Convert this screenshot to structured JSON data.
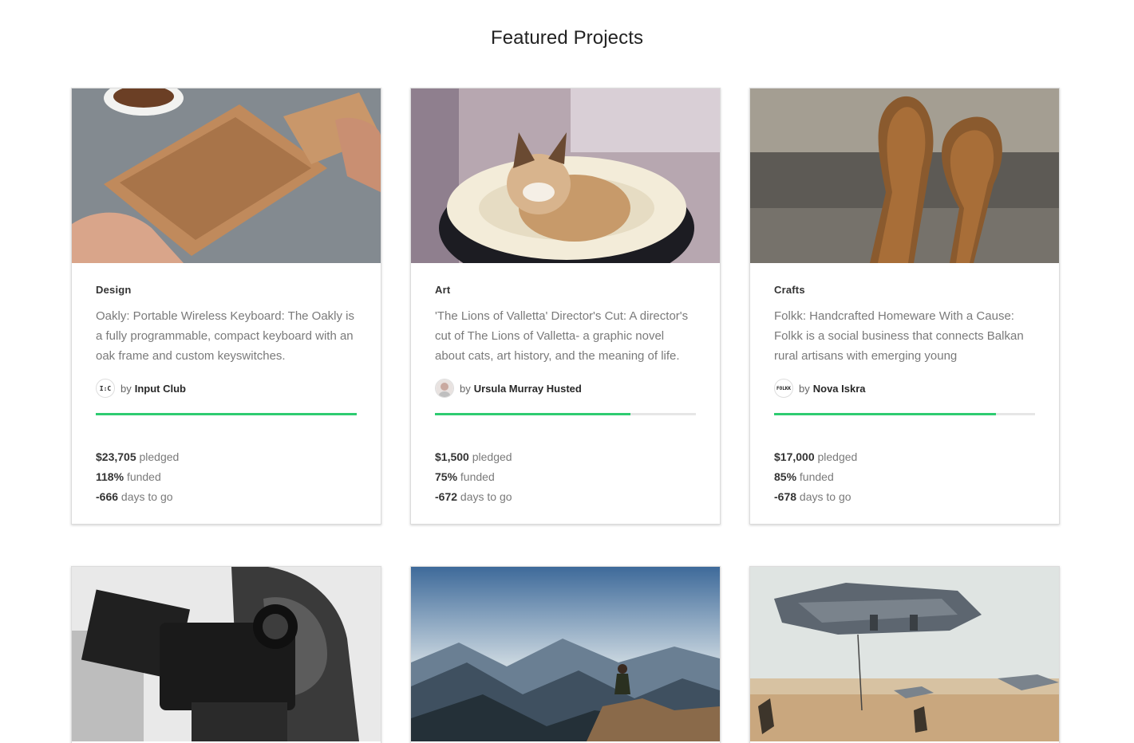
{
  "page": {
    "title": "Featured Projects"
  },
  "colors": {
    "progress": "#2ecc71",
    "track": "#e6e6e6",
    "accent_text": "#282828",
    "muted_text": "#7a7a7a"
  },
  "projects": [
    {
      "image": "wooden-keyboard-photo",
      "category": "Design",
      "blurb": "Oakly: Portable Wireless Keyboard: The Oakly is a fully programmable, compact keyboard with an oak frame and custom keyswitches.",
      "by": "by",
      "creator": "Input Club",
      "avatar_text": "I:C",
      "funded_fraction": 1.0,
      "pledged": "$23,705",
      "pledged_label": "pledged",
      "funded": "118%",
      "funded_label": "funded",
      "days": "-666",
      "days_label": "days to go"
    },
    {
      "image": "grumpy-cat-photo",
      "category": "Art",
      "blurb": "'The Lions of Valletta' Director's Cut: A director's cut of The Lions of Valletta- a graphic novel about cats, art history, and the meaning of life.",
      "by": "by",
      "creator": "Ursula Murray Husted",
      "avatar_text": "",
      "funded_fraction": 0.75,
      "pledged": "$1,500",
      "pledged_label": "pledged",
      "funded": "75%",
      "funded_label": "funded",
      "days": "-672",
      "days_label": "days to go"
    },
    {
      "image": "wooden-spoons-photo",
      "category": "Crafts",
      "blurb": "Folkk: Handcrafted Homeware With a Cause: Folkk is a social business that connects Balkan rural artisans with emerging young",
      "by": "by",
      "creator": "Nova Iskra",
      "avatar_text": "FOLKK",
      "funded_fraction": 0.85,
      "pledged": "$17,000",
      "pledged_label": "pledged",
      "funded": "85%",
      "funded_label": "funded",
      "days": "-678",
      "days_label": "days to go"
    },
    {
      "image": "camera-operator-photo"
    },
    {
      "image": "mountain-hiker-photo"
    },
    {
      "image": "helicopter-artwork"
    }
  ]
}
